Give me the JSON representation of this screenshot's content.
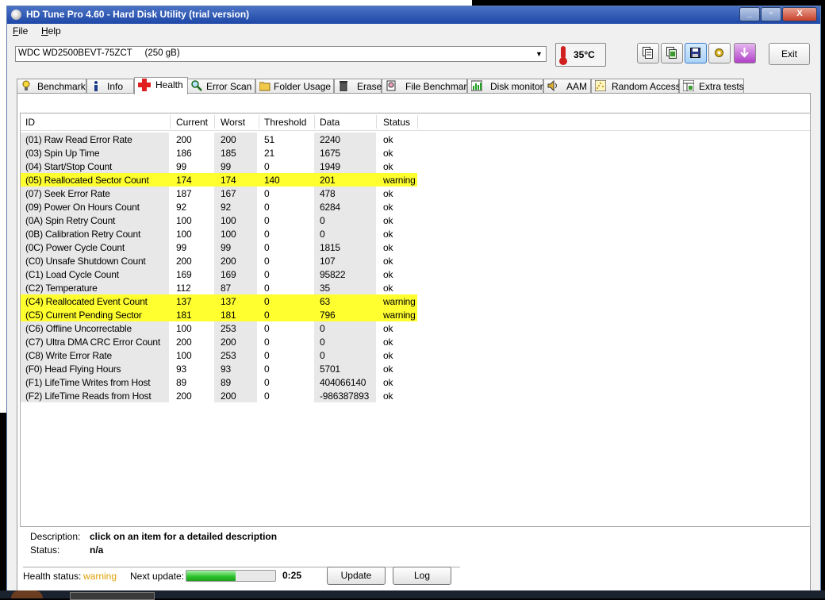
{
  "window": {
    "title": "HD Tune Pro 4.60 - Hard Disk Utility (trial version)"
  },
  "controls": {
    "minimize": "_",
    "maximize": "▫",
    "close": "X"
  },
  "menu": [
    "File",
    "Help"
  ],
  "toolbar": {
    "drive": "WDC WD2500BEVT-75ZCT     (250 gB)",
    "dropdown_arrow": "▼",
    "temperature": "35°C",
    "exit_label": "Exit",
    "icons": [
      "copy-info-icon",
      "copy-screen-icon",
      "save-icon",
      "settings-icon",
      "download-icon"
    ]
  },
  "tabs": [
    {
      "label": "Benchmark",
      "icon": "lightbulb-icon"
    },
    {
      "label": "Info",
      "icon": "info-icon"
    },
    {
      "label": "Health",
      "icon": "health-cross-icon",
      "active": true
    },
    {
      "label": "Error Scan",
      "icon": "magnifier-icon"
    },
    {
      "label": "Folder Usage",
      "icon": "folder-icon"
    },
    {
      "label": "Erase",
      "icon": "trash-icon"
    },
    {
      "label": "File Benchmark",
      "icon": "file-benchmark-icon"
    },
    {
      "label": "Disk monitor",
      "icon": "disk-monitor-icon"
    },
    {
      "label": "AAM",
      "icon": "speaker-icon"
    },
    {
      "label": "Random Access",
      "icon": "random-access-icon"
    },
    {
      "label": "Extra tests",
      "icon": "extra-tests-icon"
    }
  ],
  "table": {
    "headers": [
      "ID",
      "Current",
      "Worst",
      "Threshold",
      "Data",
      "Status"
    ],
    "rows": [
      [
        "(01) Raw Read Error Rate",
        "200",
        "200",
        "51",
        "2240",
        "ok"
      ],
      [
        "(03) Spin Up Time",
        "186",
        "185",
        "21",
        "1675",
        "ok"
      ],
      [
        "(04) Start/Stop Count",
        "99",
        "99",
        "0",
        "1949",
        "ok"
      ],
      [
        "(05) Reallocated Sector Count",
        "174",
        "174",
        "140",
        "201",
        "warning"
      ],
      [
        "(07) Seek Error Rate",
        "187",
        "167",
        "0",
        "478",
        "ok"
      ],
      [
        "(09) Power On Hours Count",
        "92",
        "92",
        "0",
        "6284",
        "ok"
      ],
      [
        "(0A) Spin Retry Count",
        "100",
        "100",
        "0",
        "0",
        "ok"
      ],
      [
        "(0B) Calibration Retry Count",
        "100",
        "100",
        "0",
        "0",
        "ok"
      ],
      [
        "(0C) Power Cycle Count",
        "99",
        "99",
        "0",
        "1815",
        "ok"
      ],
      [
        "(C0) Unsafe Shutdown Count",
        "200",
        "200",
        "0",
        "107",
        "ok"
      ],
      [
        "(C1) Load Cycle Count",
        "169",
        "169",
        "0",
        "95822",
        "ok"
      ],
      [
        "(C2) Temperature",
        "112",
        "87",
        "0",
        "35",
        "ok"
      ],
      [
        "(C4) Reallocated Event Count",
        "137",
        "137",
        "0",
        "63",
        "warning"
      ],
      [
        "(C5) Current Pending Sector",
        "181",
        "181",
        "0",
        "796",
        "warning"
      ],
      [
        "(C6) Offline Uncorrectable",
        "100",
        "253",
        "0",
        "0",
        "ok"
      ],
      [
        "(C7) Ultra DMA CRC Error Count",
        "200",
        "200",
        "0",
        "0",
        "ok"
      ],
      [
        "(C8) Write Error Rate",
        "100",
        "253",
        "0",
        "0",
        "ok"
      ],
      [
        "(F0) Head Flying Hours",
        "93",
        "93",
        "0",
        "5701",
        "ok"
      ],
      [
        "(F1) LifeTime Writes from Host",
        "89",
        "89",
        "0",
        "404066140",
        "ok"
      ],
      [
        "(F2) LifeTime Reads from Host",
        "200",
        "200",
        "0",
        "-986387893",
        "ok"
      ]
    ]
  },
  "description": {
    "label": "Description:",
    "value": "click on an item for a detailed description",
    "status_label": "Status:",
    "status_value": "n/a"
  },
  "footer": {
    "health_label": "Health status:",
    "health_value": "warning",
    "next_update_label": "Next update:",
    "progress": 0.55,
    "countdown": "0:25",
    "update_label": "Update",
    "log_label": "Log"
  },
  "colors": {
    "warning_row": "#ffff30",
    "warning_text": "#e0a000",
    "title_bar": "#1e48a8"
  }
}
